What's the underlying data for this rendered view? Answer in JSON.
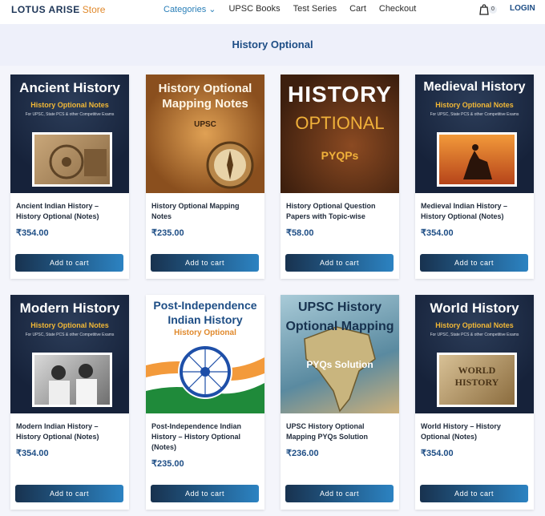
{
  "nav": {
    "logo_main": "LOTUS ARISE",
    "logo_store": "Store",
    "items": [
      "Categories ⌄",
      "UPSC Books",
      "Test Series",
      "Cart",
      "Checkout"
    ],
    "cart_count": "0",
    "login": "LOGIN"
  },
  "page": {
    "title": "History Optional"
  },
  "products": [
    {
      "name": "Ancient Indian History – History Optional (Notes)",
      "price": "₹354.00",
      "button": "Add to cart",
      "cover_title": "Ancient History",
      "cover_sub": "History Optional Notes",
      "cover_tiny": "For UPSC, State PCS & other Competitive Exams"
    },
    {
      "name": "History Optional Mapping Notes",
      "price": "₹235.00",
      "button": "Add to cart",
      "cover_title": "History Optional Mapping Notes",
      "cover_sub": "UPSC"
    },
    {
      "name": "History Optional Question Papers with Topic-wise",
      "price": "₹58.00",
      "button": "Add to cart",
      "cover_title": "HISTORY",
      "cover_sub": "OPTIONAL",
      "cover_tiny": "PYQPs"
    },
    {
      "name": "Medieval Indian History – History Optional (Notes)",
      "price": "₹354.00",
      "button": "Add to cart",
      "cover_title": "Medieval History",
      "cover_sub": "History Optional Notes",
      "cover_tiny": "For UPSC, State PCS & other Competitive Exams"
    },
    {
      "name": "Modern Indian History – History Optional (Notes)",
      "price": "₹354.00",
      "button": "Add to cart",
      "cover_title": "Modern History",
      "cover_sub": "History Optional Notes",
      "cover_tiny": "For UPSC, State PCS & other Competitive Exams"
    },
    {
      "name": "Post-Independence Indian History – History Optional (Notes)",
      "price": "₹235.00",
      "button": "Add to cart",
      "cover_title": "Post-Independence Indian History",
      "cover_sub": "History Optional"
    },
    {
      "name": "UPSC History Optional Mapping PYQs Solution",
      "price": "₹236.00",
      "button": "Add to cart",
      "cover_title": "UPSC History Optional Mapping",
      "cover_sub": "PYQs Solution"
    },
    {
      "name": "World History – History Optional (Notes)",
      "price": "₹354.00",
      "button": "Add to cart",
      "cover_title": "World History",
      "cover_sub": "History Optional Notes",
      "cover_tiny": "For UPSC, State PCS & other Competitive Exams",
      "cover_photo_text": "WORLD HISTORY"
    }
  ],
  "colors": {
    "accent": "#2a7fb8",
    "brand": "#1d4d85",
    "logo_orange": "#e0892c"
  }
}
